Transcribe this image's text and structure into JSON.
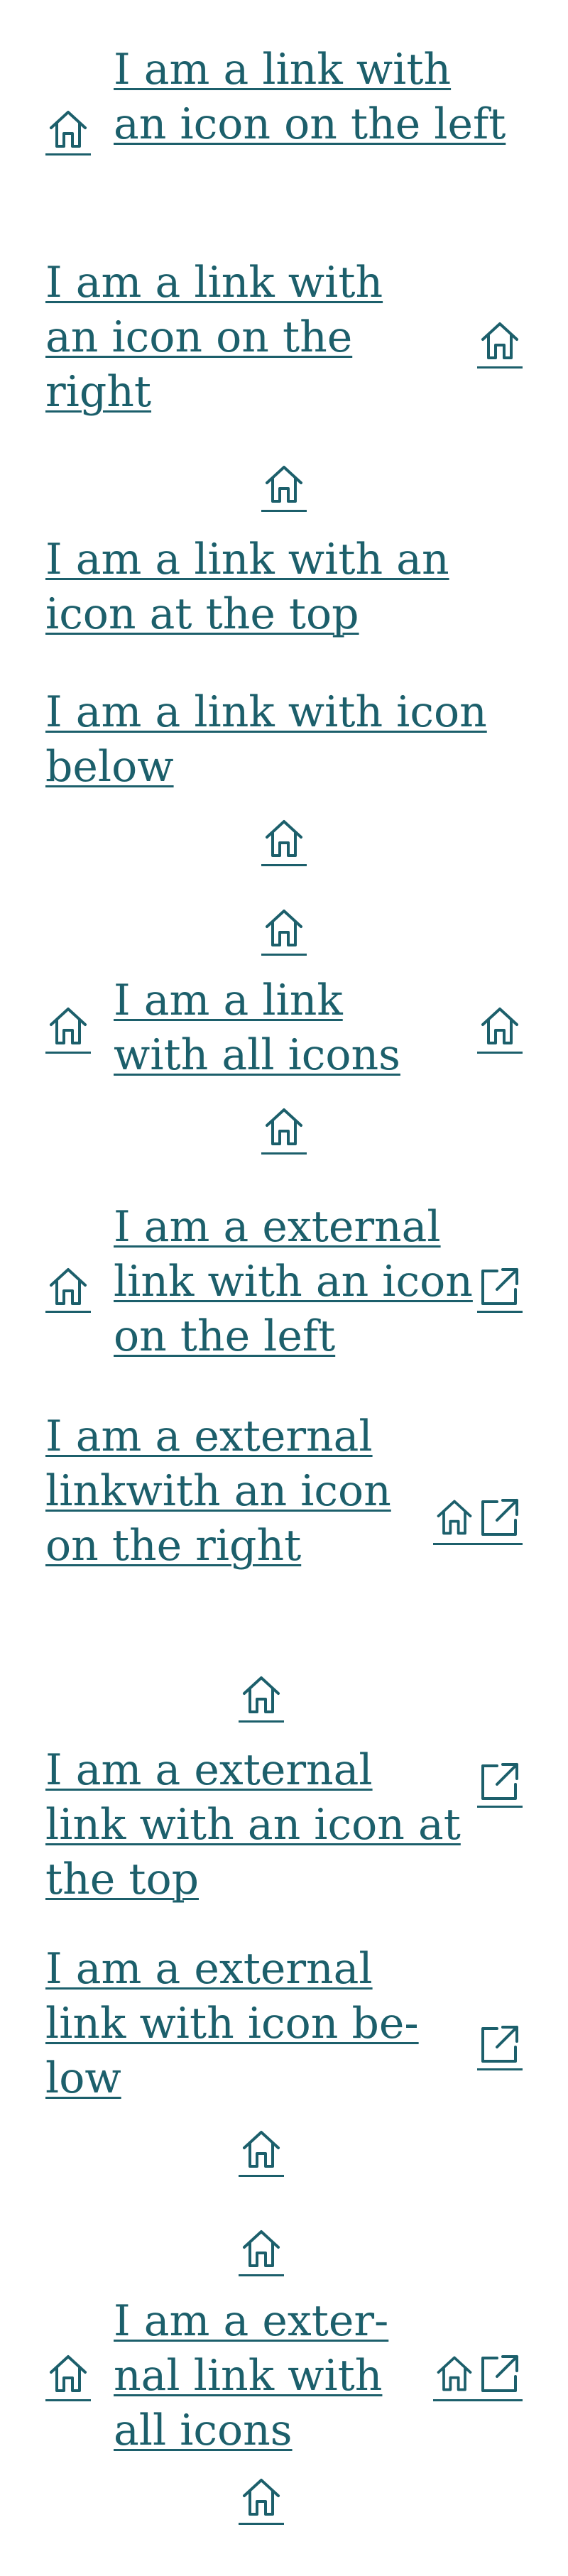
{
  "colors": {
    "link": "#1c5f6b",
    "background": "#ffffff"
  },
  "icons": {
    "home": "home-icon",
    "external": "external-link-icon"
  },
  "links": [
    {
      "text": "I am a link with an icon on the left",
      "icons": [
        "home-icon-left"
      ]
    },
    {
      "text": "I am a link with an icon on the right",
      "icons": [
        "home-icon-right"
      ]
    },
    {
      "text": "I am a link with an icon at the top",
      "icons": [
        "home-icon-top"
      ]
    },
    {
      "text": "I am a link with icon below",
      "icons": [
        "home-icon-bottom"
      ]
    },
    {
      "text": "I am a link with all icons",
      "icons": [
        "home-icon-top",
        "home-icon-left",
        "home-icon-right",
        "home-icon-bottom"
      ]
    },
    {
      "text": "I am a external link with an icon on the left",
      "icons": [
        "home-icon-left",
        "external-link-icon-right"
      ]
    },
    {
      "text": "I am a external linkwith an icon on the right",
      "icons": [
        "home-icon-right",
        "external-link-icon-right"
      ]
    },
    {
      "text": "I am a external link with an icon at the top",
      "icons": [
        "home-icon-top",
        "external-link-icon-right"
      ]
    },
    {
      "text": "I am a external link with icon be-low",
      "icons": [
        "external-link-icon-right",
        "home-icon-bottom"
      ]
    },
    {
      "text": "I am a exter-nal link with all icons",
      "icons": [
        "home-icon-top",
        "home-icon-left",
        "home-icon-right",
        "external-link-icon-right",
        "home-icon-bottom"
      ]
    }
  ]
}
